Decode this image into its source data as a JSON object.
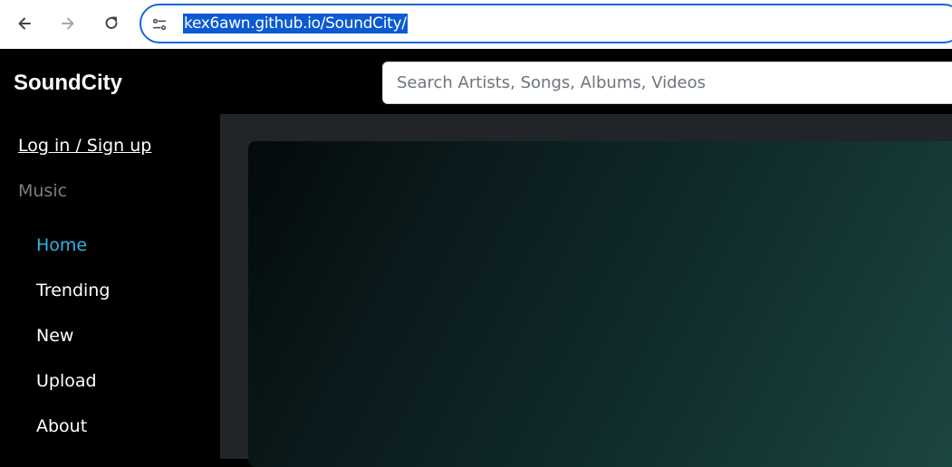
{
  "browser": {
    "url": "kex6awn.github.io/SoundCity/"
  },
  "app": {
    "logo": "SoundCity",
    "search_placeholder": "Search Artists, Songs, Albums, Videos"
  },
  "sidebar": {
    "login_label": "Log in / Sign up",
    "section_label": "Music",
    "items": [
      {
        "label": "Home",
        "active": true
      },
      {
        "label": "Trending",
        "active": false
      },
      {
        "label": "New",
        "active": false
      },
      {
        "label": "Upload",
        "active": false
      },
      {
        "label": "About",
        "active": false
      }
    ]
  },
  "colors": {
    "accent": "#2fb4e6",
    "sidebar_bg": "#000000",
    "content_bg": "#212429"
  }
}
